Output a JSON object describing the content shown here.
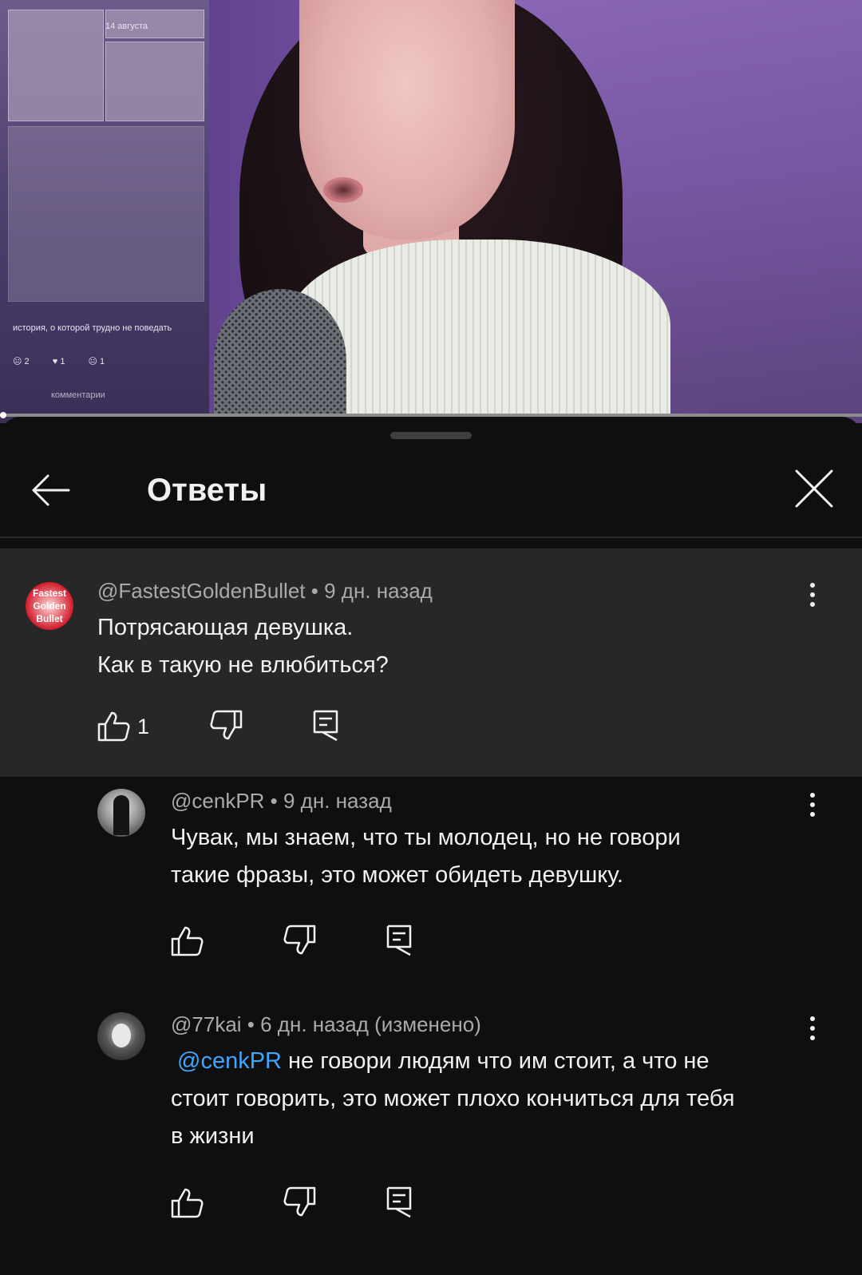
{
  "video": {
    "overlay_date": "14 августа",
    "overlay_caption": "история, о которой трудно не поведать",
    "overlay_reactions": [
      "2",
      "1",
      "1"
    ],
    "overlay_comments_label": "комментарии",
    "progress": 0.003
  },
  "header": {
    "title": "Ответы",
    "back_icon": "arrow-left-icon",
    "close_icon": "close-icon"
  },
  "parent_comment": {
    "avatar_text": "Fastest Golden Bullet",
    "author": "@FastestGoldenBullet",
    "time": "9 дн. назад",
    "lines": [
      "Потрясающая девушка.",
      "Как в такую не влюбиться?"
    ],
    "likes": "1"
  },
  "replies": [
    {
      "author": "@cenkPR",
      "time": "9 дн. назад",
      "lines": [
        "Чувак, мы знаем, что ты молодец, но не говори",
        "такие фразы, это может обидеть девушку."
      ]
    },
    {
      "author": "@77kai",
      "time": "6 дн. назад (изменено)",
      "mention": "@cenkPR",
      "line1_rest": " не говори людям что им стоит, а что не",
      "lines": [
        "стоит говорить, это может плохо кончиться для тебя",
        "в жизни"
      ]
    }
  ],
  "separator": " • "
}
